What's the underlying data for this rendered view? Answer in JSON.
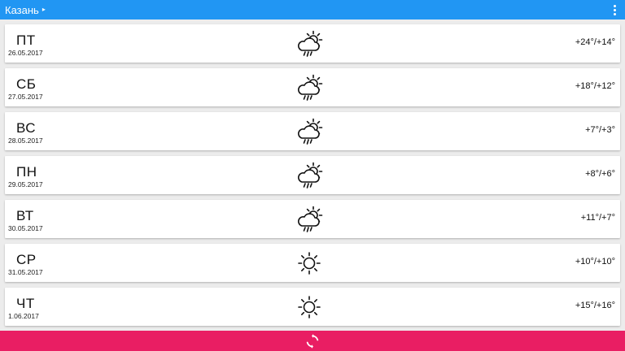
{
  "header": {
    "city": "Казань",
    "city_caret": "▸",
    "menu_icon": "more-vert-icon"
  },
  "forecast": [
    {
      "day": "ПТ",
      "date": "26.05.2017",
      "icon": "partly-cloudy-rain-icon",
      "temp": "+24°/+14°"
    },
    {
      "day": "СБ",
      "date": "27.05.2017",
      "icon": "partly-cloudy-rain-icon",
      "temp": "+18°/+12°"
    },
    {
      "day": "ВС",
      "date": "28.05.2017",
      "icon": "partly-cloudy-rain-icon",
      "temp": "+7°/+3°"
    },
    {
      "day": "ПН",
      "date": "29.05.2017",
      "icon": "partly-cloudy-rain-icon",
      "temp": "+8°/+6°"
    },
    {
      "day": "ВТ",
      "date": "30.05.2017",
      "icon": "partly-cloudy-rain-icon",
      "temp": "+11°/+7°"
    },
    {
      "day": "СР",
      "date": "31.05.2017",
      "icon": "sun-icon",
      "temp": "+10°/+10°"
    },
    {
      "day": "ЧТ",
      "date": "1.06.2017",
      "icon": "sun-icon",
      "temp": "+15°/+16°"
    }
  ],
  "footer": {
    "refresh_icon": "refresh-icon"
  },
  "colors": {
    "topbar": "#2196f3",
    "bottombar": "#e91e63",
    "background": "#ececec"
  }
}
